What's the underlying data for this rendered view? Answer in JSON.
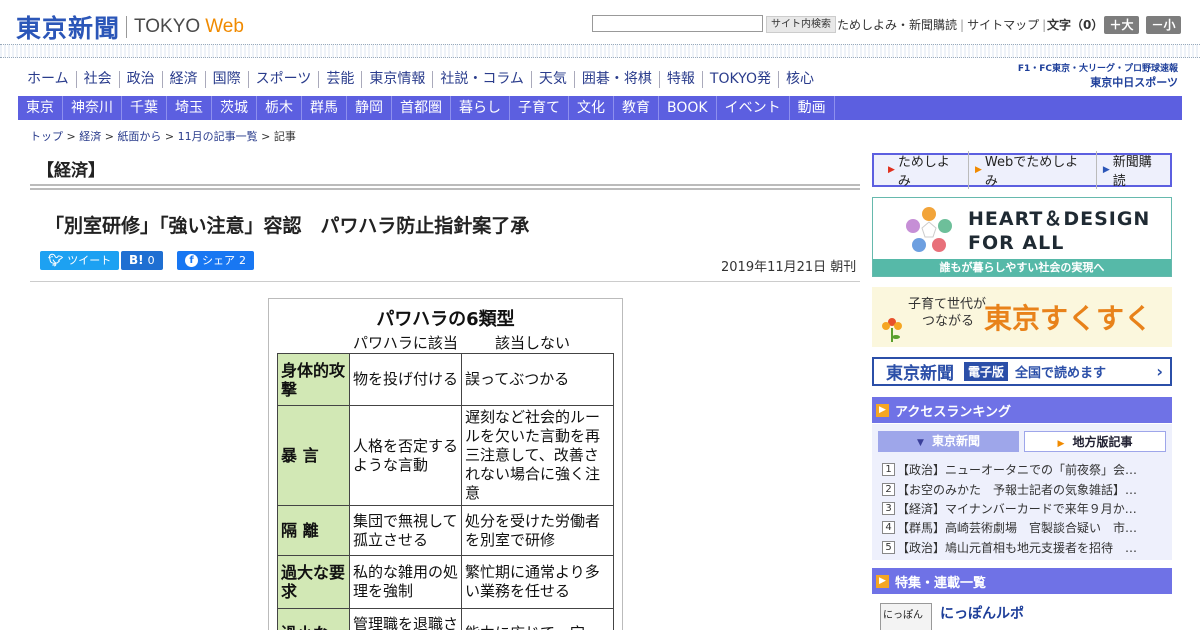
{
  "header": {
    "logo_jp": "東京新聞",
    "logo_en": "TOKYO",
    "logo_web": "Web",
    "search_button": "サイト内検索",
    "links": [
      "ためしよみ・新聞購読",
      "サイトマップ"
    ],
    "font_label": "文字（0）",
    "font_plus": "＋大",
    "font_minus": "－小"
  },
  "main_nav": [
    "ホーム",
    "社会",
    "政治",
    "経済",
    "国際",
    "スポーツ",
    "芸能",
    "東京情報",
    "社説・コラム",
    "天気",
    "囲碁・将棋",
    "特報",
    "TOKYO発",
    "核心"
  ],
  "chunichi": {
    "line1": "F1・FC東京・大リーグ・プロ野球速報",
    "line2": "東京中日スポーツ"
  },
  "sub_nav": [
    "東京",
    "神奈川",
    "千葉",
    "埼玉",
    "茨城",
    "栃木",
    "群馬",
    "静岡",
    "首都圏",
    "暮らし",
    "子育て",
    "文化",
    "教育",
    "BOOK",
    "イベント",
    "動画"
  ],
  "breadcrumb": [
    "トップ",
    "経済",
    "紙面から",
    "11月の記事一覧",
    "記事"
  ],
  "article": {
    "section": "【経済】",
    "headline": "「別室研修」「強い注意」容認　パワハラ防止指針案了承",
    "date": "2019年11月21日 朝刊",
    "share": {
      "tweet": "ツイート",
      "hatena_icon": "B!",
      "hatena_count": "0",
      "fb_label": "シェア",
      "fb_count": "2"
    }
  },
  "figure": {
    "title": "パワハラの6類型",
    "col_yes": "パワハラに該当",
    "col_no": "該当しない",
    "rows": [
      {
        "cat": "身体的攻撃",
        "yes": "物を投げ付ける",
        "no": "誤ってぶつかる"
      },
      {
        "cat": "暴 言",
        "yes": "人格を否定するような言動",
        "no": "遅刻など社会的ルールを欠いた言動を再三注意して、改善されない場合に強く注意"
      },
      {
        "cat": "隔 離",
        "yes": "集団で無視して孤立させる",
        "no": "処分を受けた労働者を別室で研修"
      },
      {
        "cat": "過大な要求",
        "yes": "私的な雑用の処理を強制",
        "no": "繁忙期に通常より多い業務を任せる"
      },
      {
        "cat": "過小な",
        "yes": "管理職を退職させるため",
        "no": "能力に応じて一定"
      }
    ]
  },
  "sidebar": {
    "top_links": [
      "ためしよみ",
      "Webでためしよみ",
      "新聞購読"
    ],
    "hd_title_1": "HEART＆DESIGN",
    "hd_title_2": "FOR ALL",
    "hd_band": "誰もが暮らしやすい社会の実現へ",
    "sk_small_1": "子育て世代が",
    "sk_small_2": "つながる",
    "sk_big": "東京すくすく",
    "ep_logo": "東京新聞",
    "ep_tag": "電子版",
    "ep_text": "全国で読めます",
    "ranking_title": "アクセスランキング",
    "ranking_tabs": [
      "東京新聞",
      "地方版記事"
    ],
    "ranking": [
      "【政治】ニューオータニでの「前夜祭」会…",
      "【お空のみかた　予報士記者の気象雑話】…",
      "【経済】マイナンバーカードで来年９月か…",
      "【群馬】高崎芸術劇場　官製談合疑い　市…",
      "【政治】鳩山元首相も地元支援者を招待　…"
    ],
    "feature_title": "特集・連載一覧",
    "feature_item": "にっぽんルポ",
    "feature_thumb": "にっぽん"
  },
  "colors": {
    "brand_blue": "#2b56b8",
    "nav_purple": "#5c5fe0",
    "accent_orange": "#f08a00",
    "teal": "#56b9a8"
  }
}
